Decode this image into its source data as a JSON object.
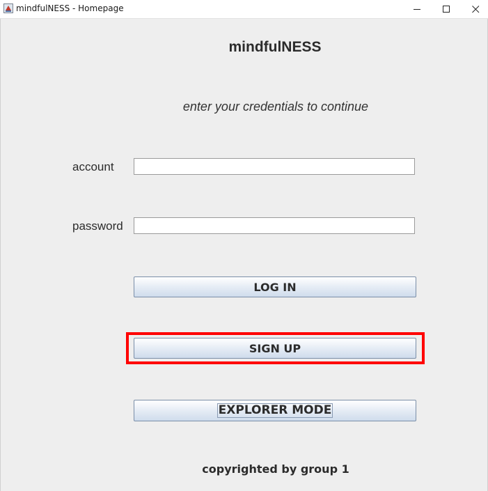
{
  "window": {
    "title": "mindfulNESS - Homepage",
    "controls": {
      "minimize_icon": "minimize-icon",
      "maximize_icon": "maximize-icon",
      "close_icon": "close-icon"
    }
  },
  "main": {
    "heading": "mindfulNESS",
    "subheading": "enter your credentials to continue",
    "account_label": "account",
    "account_value": "",
    "password_label": "password",
    "password_value": ""
  },
  "buttons": {
    "login": "LOG IN",
    "signup": "SIGN UP",
    "explorer": "EXPLORER MODE"
  },
  "footer": {
    "text": "copyrighted by group 1"
  },
  "colors": {
    "background": "#eeeeee",
    "highlight": "#ff0000",
    "button_border": "#7a8ea8"
  }
}
